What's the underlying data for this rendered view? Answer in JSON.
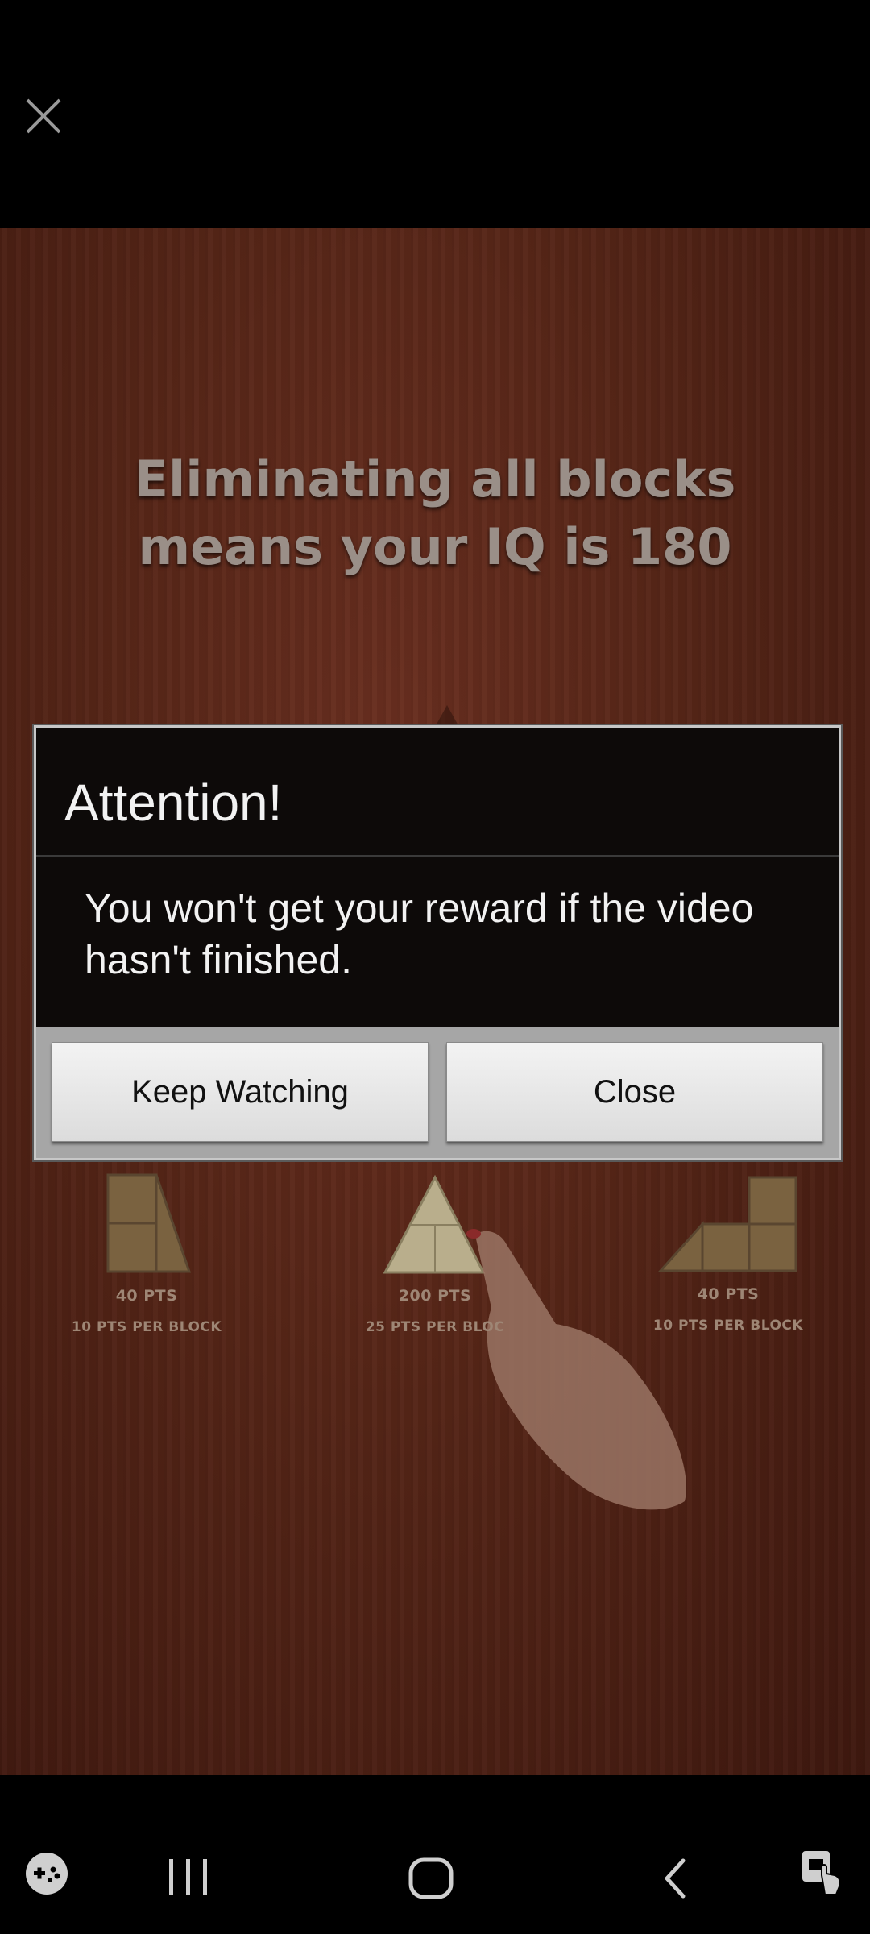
{
  "ad": {
    "close_icon": "close-icon",
    "headline_line1": "Eliminating all blocks",
    "headline_line2": "means your IQ is 180",
    "examples": [
      {
        "points": "40 PTS",
        "per_block": "10 PTS PER BLOCK"
      },
      {
        "points": "200 PTS",
        "per_block": "25 PTS PER BLOC"
      },
      {
        "points": "40 PTS",
        "per_block": "10 PTS PER BLOCK"
      }
    ]
  },
  "dialog": {
    "title": "Attention!",
    "message": "You won't get your reward if the video hasn't finished.",
    "keep_watching_label": "Keep Watching",
    "close_label": "Close"
  },
  "nav": {
    "icons": [
      "game-launcher-icon",
      "recent-apps-icon",
      "home-icon",
      "back-icon",
      "accessibility-icon"
    ]
  },
  "colors": {
    "dialog_bg": "#0d0a09",
    "dialog_frame": "#a6a6a6",
    "button_bg": "#e8e8e8",
    "wood": "#552517"
  }
}
